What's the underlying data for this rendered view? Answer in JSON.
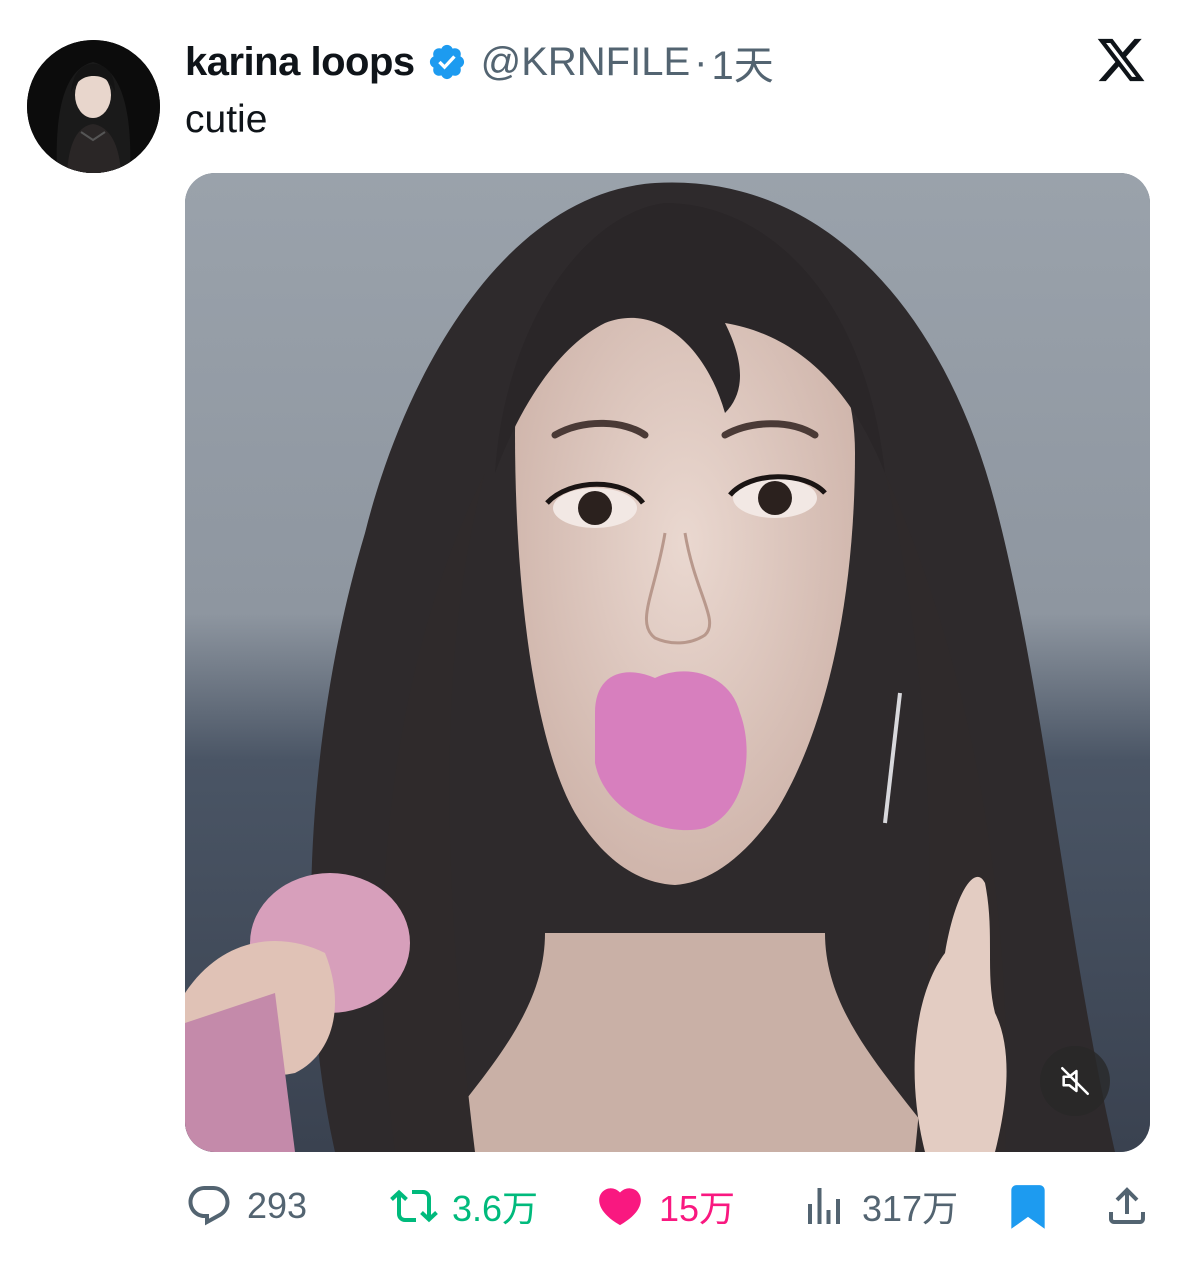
{
  "tweet": {
    "display_name": "karina loops",
    "verified_icon": "verified-badge-icon",
    "handle": "@KRNFILE",
    "separator": "·",
    "time": "1天",
    "text": "cutie"
  },
  "media": {
    "type": "video",
    "mute_icon": "sound-off-icon"
  },
  "actions": {
    "reply": {
      "icon": "reply-icon",
      "count": "293"
    },
    "retweet": {
      "icon": "retweet-icon",
      "count": "3.6万"
    },
    "like": {
      "icon": "heart-icon",
      "count": "15万"
    },
    "views": {
      "icon": "views-icon",
      "count": "317万"
    },
    "bookmark": {
      "icon": "bookmark-icon"
    },
    "share": {
      "icon": "share-icon"
    }
  },
  "colors": {
    "text": "#0f1419",
    "secondary": "#536471",
    "verified": "#1d9bf0",
    "retweet_active": "#00ba7c",
    "like_active": "#f91880",
    "bookmark_active": "#1d9bf0"
  }
}
